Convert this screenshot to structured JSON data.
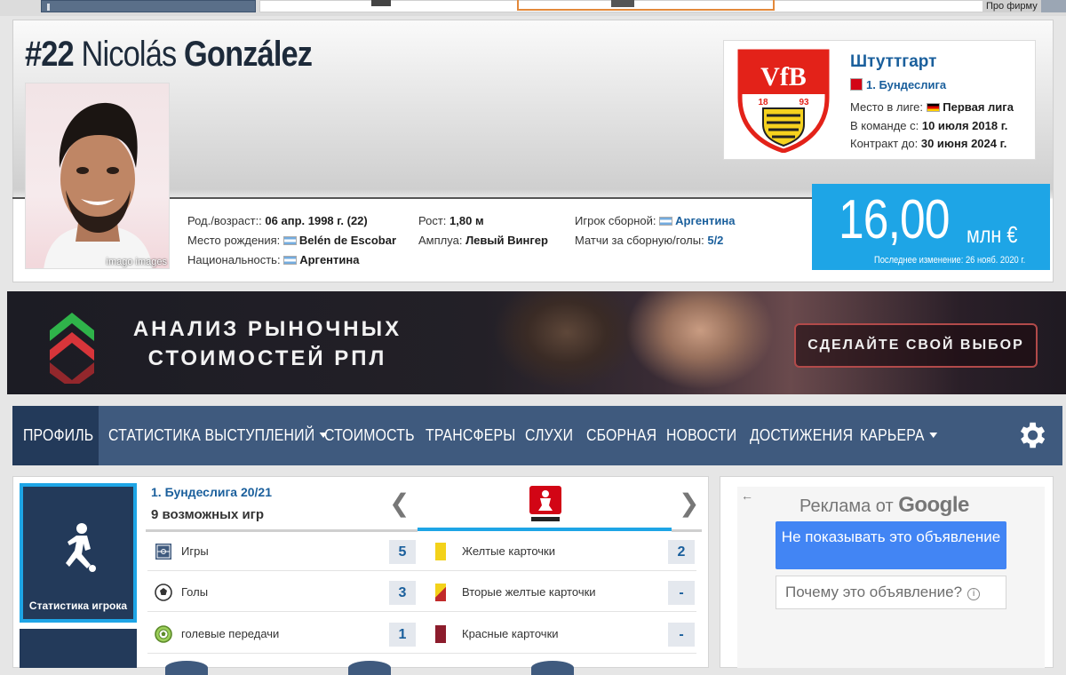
{
  "top_strip": {
    "pro_label": "Про фирму"
  },
  "player": {
    "number": "#22",
    "first_name": "Nicolás",
    "last_name": "González",
    "photo_copyright": "imago images",
    "facts": {
      "birth_label": "Род./возраст::",
      "birth_value": "06 апр. 1998 г. (22)",
      "birthplace_label": "Место рождения:",
      "birthplace_value": "Belén de Escobar",
      "nationality_label": "Национальность:",
      "nationality_value": "Аргентина",
      "height_label": "Рост:",
      "height_value": "1,80 м",
      "position_label": "Амплуа:",
      "position_value": "Левый Вингер",
      "national_label": "Игрок сборной:",
      "national_value": "Аргентина",
      "caps_label": "Матчи за сборную/голы:",
      "caps_value": "5/2"
    }
  },
  "club": {
    "name": "Штуттгарт",
    "league": "1. Бундеслига",
    "league_level_label": "Место в лиге:",
    "league_level_value": "Первая лига",
    "joined_label": "В команде с:",
    "joined_value": "10 июля 2018 г.",
    "contract_label": "Контракт до:",
    "contract_value": "30 июня 2024 г."
  },
  "market_value": {
    "value": "16,00",
    "unit": "млн €",
    "last_change": "Последнее изменение: 26 нояб. 2020 г."
  },
  "banner": {
    "line1": "АНАЛИЗ РЫНОЧНЫХ",
    "line2": "СТОИМОСТЕЙ РПЛ",
    "cta": "СДЕЛАЙТЕ СВОЙ ВЫБОР"
  },
  "nav": {
    "items": [
      {
        "label": "ПРОФИЛЬ",
        "active": true
      },
      {
        "label": "СТАТИСТИКА ВЫСТУПЛЕНИЙ",
        "dropdown": true
      },
      {
        "label": "СТОИМОСТЬ"
      },
      {
        "label": "ТРАНСФЕРЫ"
      },
      {
        "label": "СЛУХИ"
      },
      {
        "label": "СБОРНАЯ"
      },
      {
        "label": "НОВОСТИ"
      },
      {
        "label": "ДОСТИЖЕНИЯ"
      },
      {
        "label": "КАРЬЕРА",
        "dropdown": true
      }
    ]
  },
  "stats": {
    "tile_label": "Статистика игрока",
    "league_season": "1. Бундеслига 20/21",
    "possible_games": "9 возможных игр",
    "prev_arrow": "❮",
    "next_arrow": "❯",
    "left_rows": [
      {
        "label": "Игры",
        "value": "5",
        "icon": "pitch-icon"
      },
      {
        "label": "Голы",
        "value": "3",
        "icon": "ball-icon"
      },
      {
        "label": "голевые передачи",
        "value": "1",
        "icon": "assist-ball-icon"
      }
    ],
    "right_rows": [
      {
        "label": "Желтые карточки",
        "value": "2",
        "icon": "yellow-card-icon"
      },
      {
        "label": "Вторые желтые карточки",
        "value": "-",
        "icon": "second-yellow-card-icon"
      },
      {
        "label": "Красные карточки",
        "value": "-",
        "icon": "red-card-icon"
      }
    ]
  },
  "ad": {
    "back_arrow": "←",
    "heading_prefix": "Реклама от",
    "heading_brand": "Google",
    "hide_button": "Не показывать это объявление",
    "why_button": "Почему это объявление?",
    "info_glyph": "i"
  },
  "colors": {
    "nav_bg": "#3f5a7e",
    "nav_active": "#233a5a",
    "accent_blue": "#1ea5e6",
    "link_blue": "#1a5f9c",
    "google_blue": "#4285f4"
  }
}
